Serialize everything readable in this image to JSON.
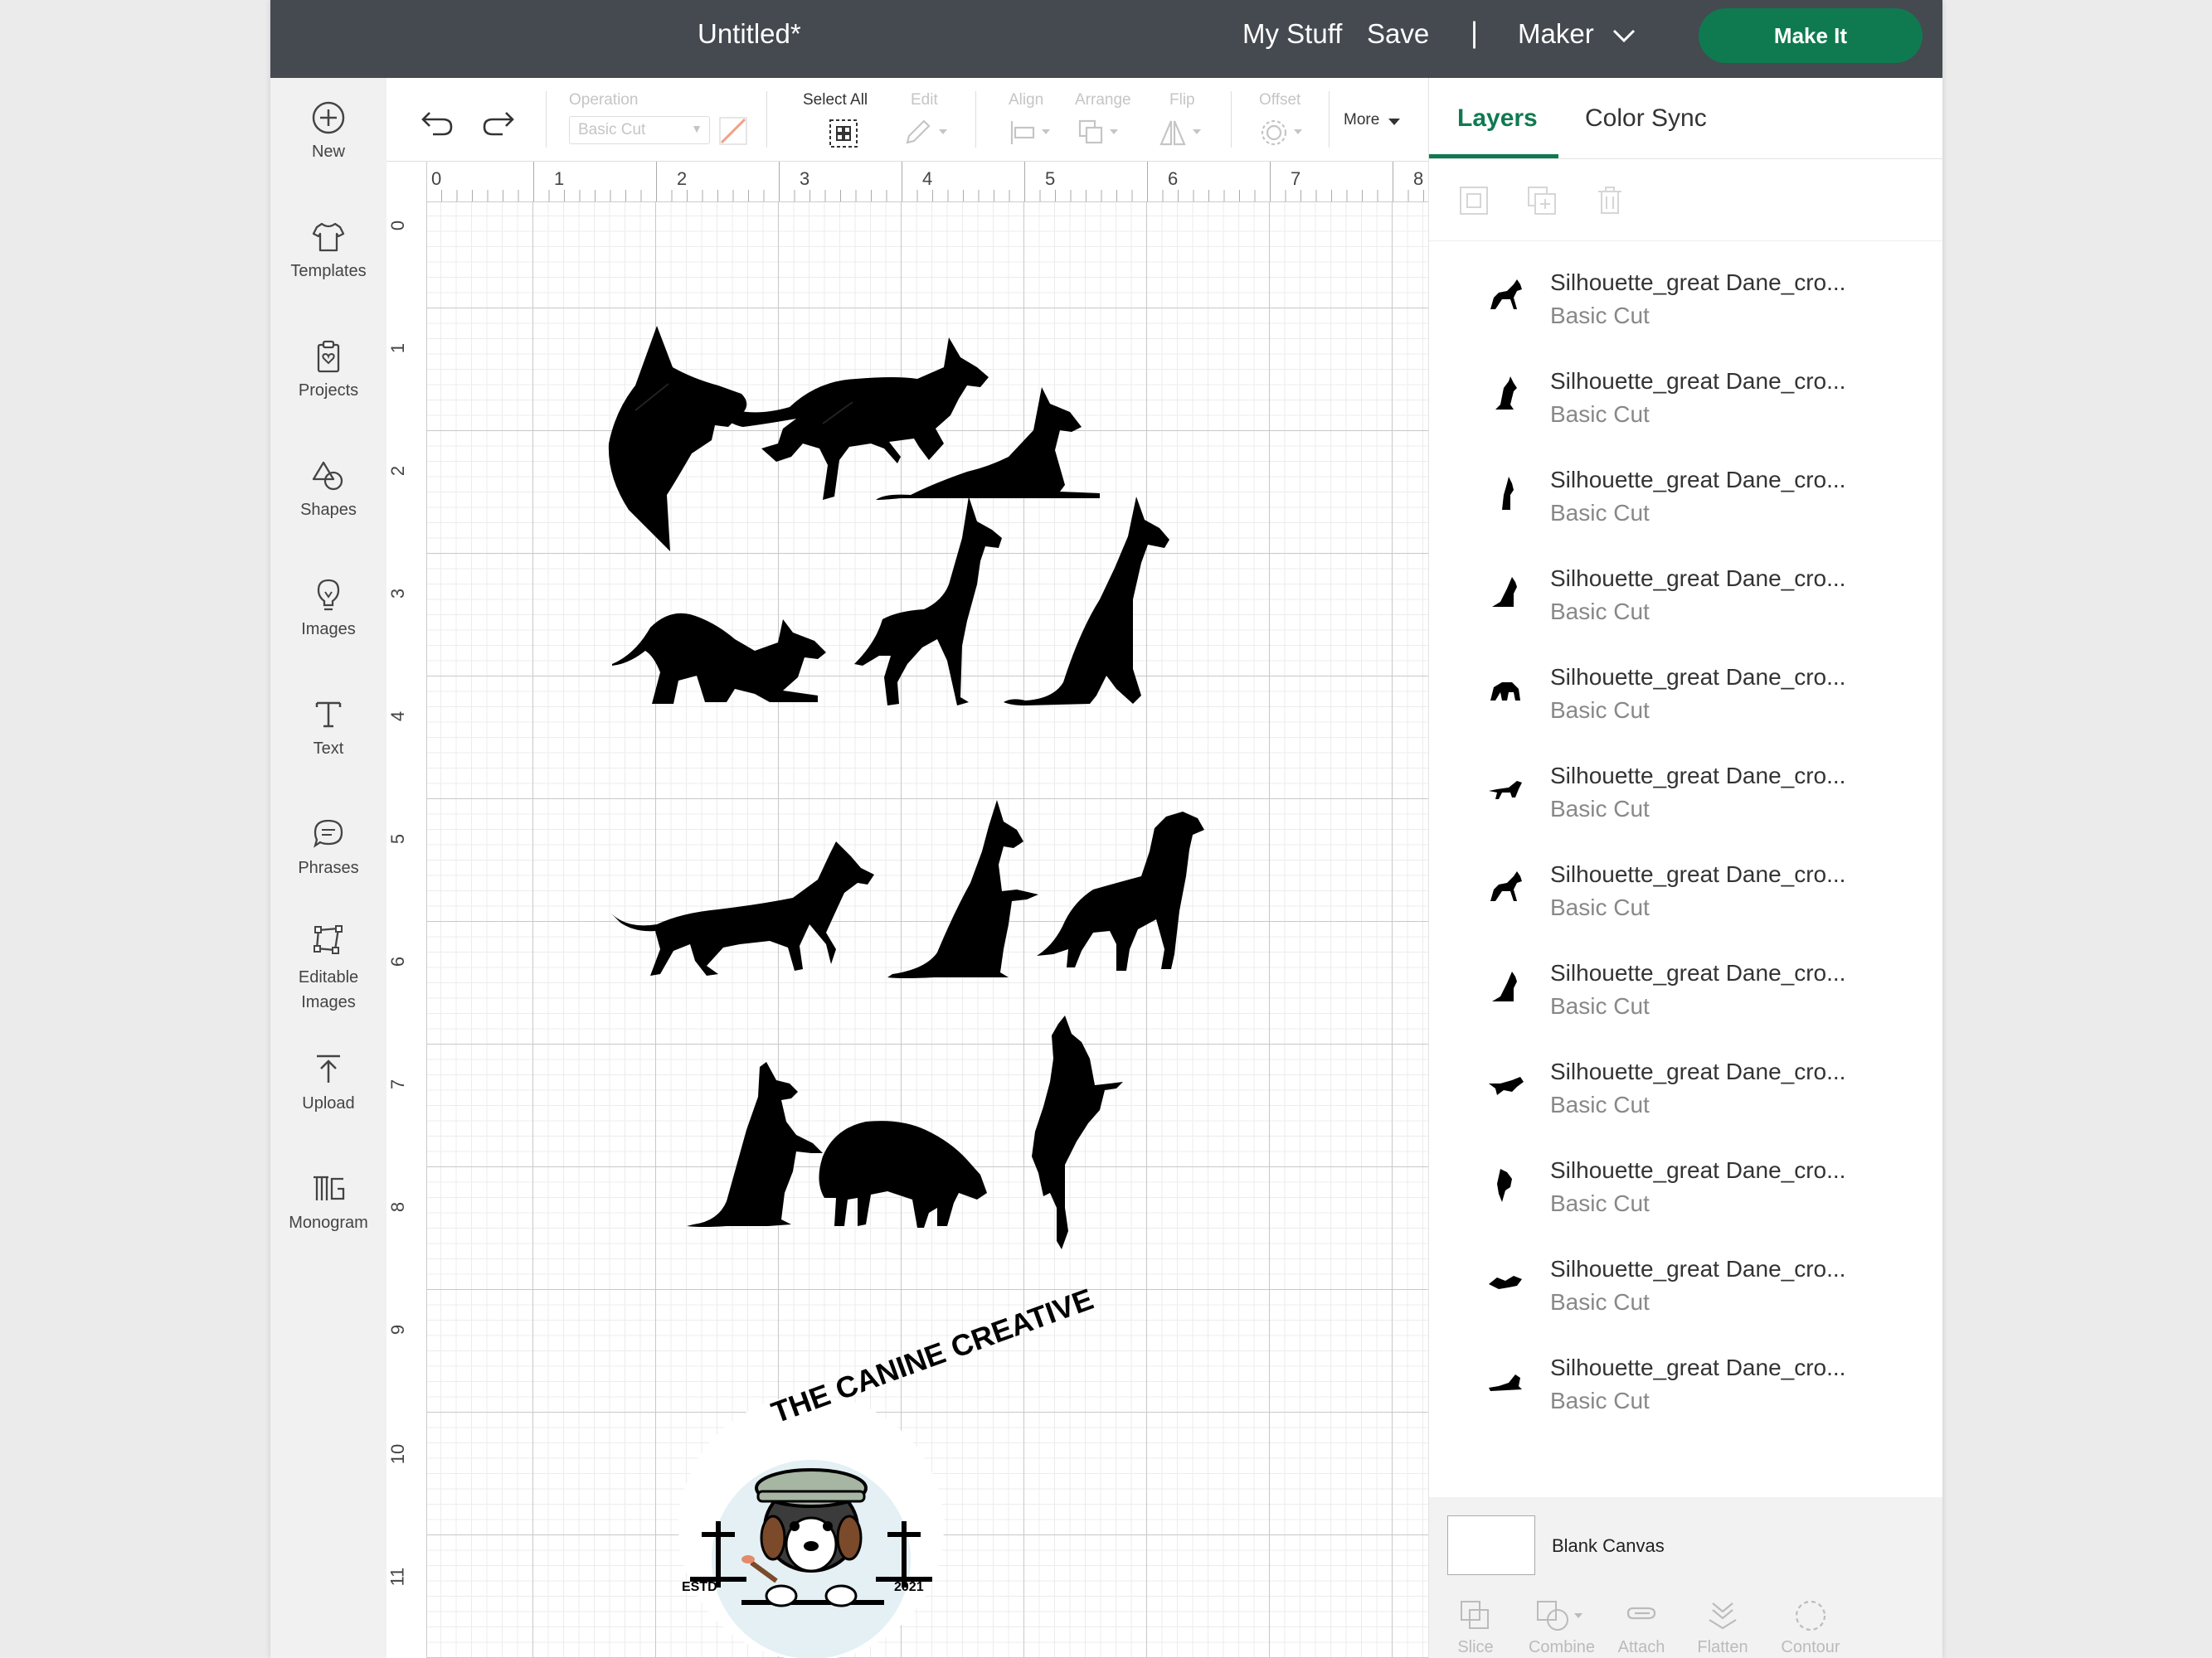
{
  "topbar": {
    "title": "Untitled*",
    "my_stuff": "My Stuff",
    "save": "Save",
    "separator": "|",
    "machine": "Maker",
    "make_it": "Make It"
  },
  "sidebar": {
    "items": [
      {
        "label": "New",
        "icon": "plus-circle-icon"
      },
      {
        "label": "Templates",
        "icon": "tshirt-icon"
      },
      {
        "label": "Projects",
        "icon": "clipboard-icon"
      },
      {
        "label": "Shapes",
        "icon": "shapes-icon"
      },
      {
        "label": "Images",
        "icon": "lightbulb-icon"
      },
      {
        "label": "Text",
        "icon": "text-icon"
      },
      {
        "label": "Phrases",
        "icon": "speech-bubble-icon"
      },
      {
        "label": "Editable Images",
        "icon": "editable-images-icon"
      },
      {
        "label": "Upload",
        "icon": "upload-icon"
      },
      {
        "label": "Monogram",
        "icon": "monogram-icon"
      }
    ]
  },
  "toolbar": {
    "operation_label": "Operation",
    "operation_value": "Basic Cut",
    "select_all": "Select All",
    "edit": "Edit",
    "align": "Align",
    "arrange": "Arrange",
    "flip": "Flip",
    "offset": "Offset",
    "more": "More"
  },
  "ruler": {
    "top": [
      "0",
      "1",
      "2",
      "3",
      "4",
      "5",
      "6",
      "7",
      "8"
    ],
    "left": [
      "0",
      "1",
      "2",
      "3",
      "4",
      "5",
      "6",
      "7",
      "8",
      "9",
      "10",
      "11"
    ]
  },
  "canvas": {
    "logo_top_text": "THE CANINE CREATIVE",
    "logo_left": "ESTD",
    "logo_right": "2021"
  },
  "panel": {
    "tabs": [
      "Layers",
      "Color Sync"
    ],
    "layers": [
      {
        "name": "Silhouette_great Dane_cro...",
        "operation": "Basic Cut"
      },
      {
        "name": "Silhouette_great Dane_cro...",
        "operation": "Basic Cut"
      },
      {
        "name": "Silhouette_great Dane_cro...",
        "operation": "Basic Cut"
      },
      {
        "name": "Silhouette_great Dane_cro...",
        "operation": "Basic Cut"
      },
      {
        "name": "Silhouette_great Dane_cro...",
        "operation": "Basic Cut"
      },
      {
        "name": "Silhouette_great Dane_cro...",
        "operation": "Basic Cut"
      },
      {
        "name": "Silhouette_great Dane_cro...",
        "operation": "Basic Cut"
      },
      {
        "name": "Silhouette_great Dane_cro...",
        "operation": "Basic Cut"
      },
      {
        "name": "Silhouette_great Dane_cro...",
        "operation": "Basic Cut"
      },
      {
        "name": "Silhouette_great Dane_cro...",
        "operation": "Basic Cut"
      },
      {
        "name": "Silhouette_great Dane_cro...",
        "operation": "Basic Cut"
      },
      {
        "name": "Silhouette_great Dane_cro...",
        "operation": "Basic Cut"
      }
    ],
    "blank_canvas": "Blank Canvas",
    "bottom_tools": [
      "Slice",
      "Combine",
      "Attach",
      "Flatten",
      "Contour"
    ]
  },
  "colors": {
    "topbar": "#444a50",
    "accent": "#0f7a50",
    "sidebar": "#f1f1f1"
  }
}
